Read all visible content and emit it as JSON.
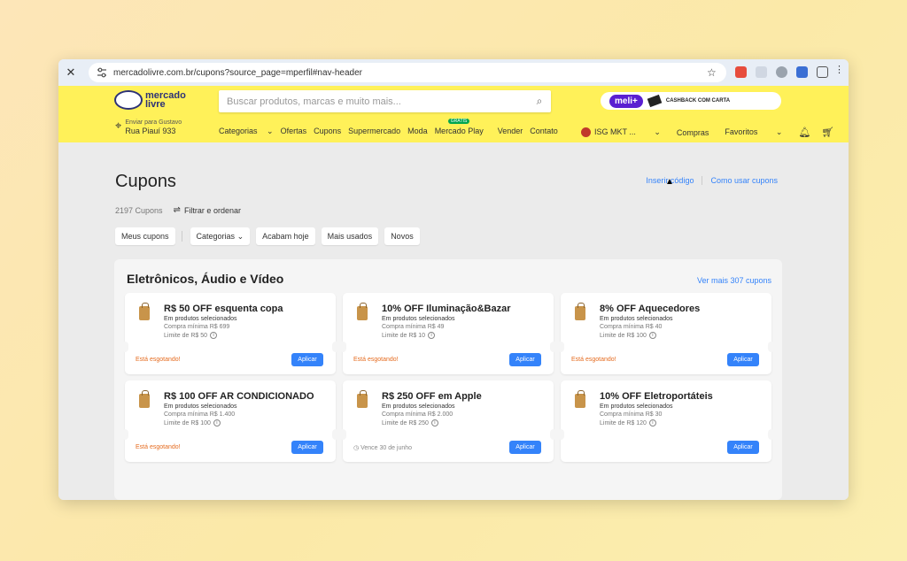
{
  "browser": {
    "url": "mercadolivre.com.br/cupons?source_page=mperfil#nav-header"
  },
  "header": {
    "logo_text": "mercado livre",
    "search_placeholder": "Buscar produtos, marcas e muito mais...",
    "promo_badge": "meli+",
    "promo_text": "CASHBACK COM CARTA",
    "deliver_line1": "Enviar para Gustavo",
    "deliver_line2": "Rua Piauí 933",
    "nav": [
      "Categorias",
      "Ofertas",
      "Cupons",
      "Supermercado",
      "Moda",
      "Mercado Play",
      "Vender",
      "Contato"
    ],
    "nav_new_badge": "GRÁTIS",
    "user": "ISG MKT ...",
    "right_nav": [
      "Compras",
      "Favoritos"
    ]
  },
  "page": {
    "title": "Cupons",
    "insert_code": "Inserir código",
    "how_to": "Como usar cupons",
    "count": "2197 Cupons",
    "filter": "Filtrar e ordenar",
    "chips": [
      "Meus cupons",
      "Categorias",
      "Acabam hoje",
      "Mais usados",
      "Novos"
    ]
  },
  "section": {
    "title": "Eletrônicos, Áudio e Vídeo",
    "see_more": "Ver mais 307 cupons",
    "apply_label": "Aplicar",
    "coupons": [
      {
        "title": "R$ 50 OFF esquenta copa",
        "sub": "Em produtos selecionados",
        "min": "Compra mínima R$ 699",
        "limit": "Limite de R$ 50",
        "status": "Está esgotando!"
      },
      {
        "title": "10% OFF Iluminação&Bazar",
        "sub": "Em produtos selecionados",
        "min": "Compra mínima R$ 49",
        "limit": "Limite de R$ 10",
        "status": "Está esgotando!"
      },
      {
        "title": "8% OFF Aquecedores",
        "sub": "Em produtos selecionados",
        "min": "Compra mínima R$ 40",
        "limit": "Limite de R$ 100",
        "status": "Está esgotando!"
      },
      {
        "title": "R$ 100 OFF AR CONDICIONADO",
        "sub": "Em produtos selecionados",
        "min": "Compra mínima R$ 1.400",
        "limit": "Limite de R$ 100",
        "status": "Está esgotando!"
      },
      {
        "title": "R$ 250 OFF em Apple",
        "sub": "Em produtos selecionados",
        "min": "Compra mínima R$ 2.000",
        "limit": "Limite de R$ 250",
        "status": "Vence 30 de junho"
      },
      {
        "title": "10% OFF Eletroportáteis",
        "sub": "Em produtos selecionados",
        "min": "Compra mínima R$ 30",
        "limit": "Limite de R$ 120",
        "status": ""
      }
    ]
  }
}
